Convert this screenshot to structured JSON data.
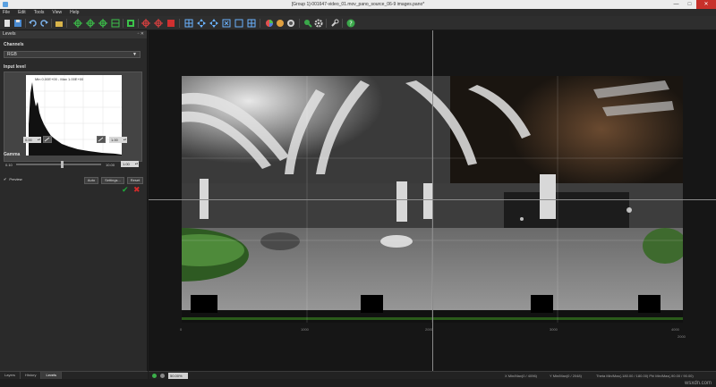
{
  "window": {
    "title": "[Group 1]-001647-video_01.mov_pano_source_06-9 images.pano*",
    "minimize": "—",
    "maximize": "□",
    "close": "✕"
  },
  "menu": [
    "File",
    "Edit",
    "Tools",
    "View",
    "Help"
  ],
  "panel": {
    "title": "Levels",
    "pin": "▫ ✕",
    "channels_label": "Channels",
    "channel_value": "RGB",
    "input_level_label": "Input level",
    "histogram_minmax": "Min 0.00E+00 - Max 1.00E+00",
    "input_min": "0.00",
    "input_max": "1.00",
    "gamma_label": "Gamma",
    "gamma_min": "0.10",
    "gamma_max": "10.00",
    "gamma_value": "1.00",
    "preview_label": "Preview",
    "auto_label": "Auto",
    "settings_label": "Settings...",
    "reset_label": "Reset"
  },
  "panel_tabs": [
    "Layers",
    "History",
    "Levels"
  ],
  "viewport": {
    "ruler_x": [
      "0",
      "1000",
      "2000",
      "3000",
      "4000"
    ],
    "ruler_y": "2000"
  },
  "status": {
    "zoom": "50.00%",
    "left_text": "X Min/Max(0 / 4096)",
    "mid_text": "Y Min/Max(0 / 2048)",
    "right_text": "Theta Min/Max(-180.00 / 180.00)  Phi Min/Max(-90.00 / 90.00)"
  },
  "watermark": "wsxdn.com",
  "colors": {
    "accent_green": "#1fa83a",
    "cancel_red": "#d42a2a",
    "titlebar": "#ececec",
    "background": "#1e1e1e"
  }
}
